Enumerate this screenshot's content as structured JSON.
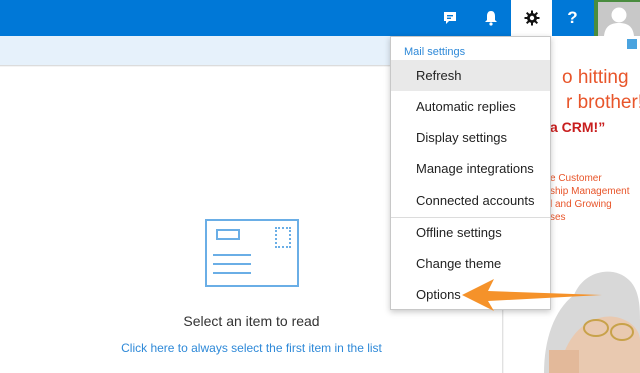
{
  "header": {
    "chat_icon": "chat-icon",
    "notifications_icon": "bell-icon",
    "settings_icon": "gear-icon",
    "help_label": "?",
    "avatar_icon": "user-avatar-icon",
    "colors": {
      "bar": "#0078d7",
      "avatar_accent": "#4a8c3f"
    }
  },
  "settings_menu": {
    "header": "Mail settings",
    "items": [
      {
        "label": "Refresh",
        "hovered": true
      },
      {
        "label": "Automatic replies"
      },
      {
        "label": "Display settings"
      },
      {
        "label": "Manage integrations"
      },
      {
        "label": "Connected accounts"
      },
      {
        "label": "Offline settings"
      },
      {
        "label": "Change theme"
      },
      {
        "label": "Options"
      }
    ]
  },
  "reading_pane": {
    "empty_icon": "envelope-icon",
    "title": "Select an item to read",
    "link": "Click here to always select the first item in the list"
  },
  "ad": {
    "line1": "o hitting",
    "line2": "r brother!",
    "line3": "a CRM!”",
    "small_lines": [
      "e Customer",
      "ship Management",
      "l and Growing",
      "ses"
    ],
    "adchoices_icon": "adchoices-icon"
  }
}
